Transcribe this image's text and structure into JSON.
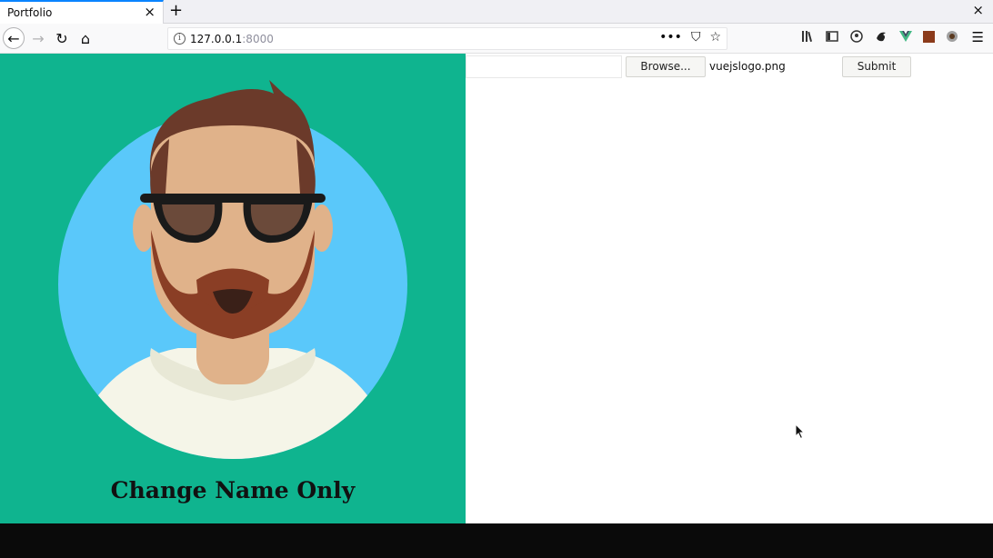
{
  "browser": {
    "tab_title": "Portfolio",
    "tab_close": "×",
    "new_tab": "+",
    "window_close": "×",
    "url_host": "127.0.0.1",
    "url_port": ":8000",
    "url_info_glyph": "i",
    "url_actions": [
      "•••",
      "⛉",
      "☆"
    ],
    "toolbar_icons": [
      "library-icon",
      "sidebar-icon",
      "account-icon",
      "extension-e-icon",
      "vue-devtools-icon",
      "extension-square-icon",
      "extension-globe-icon"
    ],
    "menu": "☰"
  },
  "nav": {
    "back": "←",
    "forward": "→",
    "reload": "↻",
    "home": "⌂"
  },
  "page": {
    "heading": "Change Name Only",
    "panel_color": "#0fb48f",
    "form": {
      "text_value": "",
      "browse_label": "Browse...",
      "file_name": "vuejslogo.png",
      "submit_label": "Submit"
    }
  }
}
